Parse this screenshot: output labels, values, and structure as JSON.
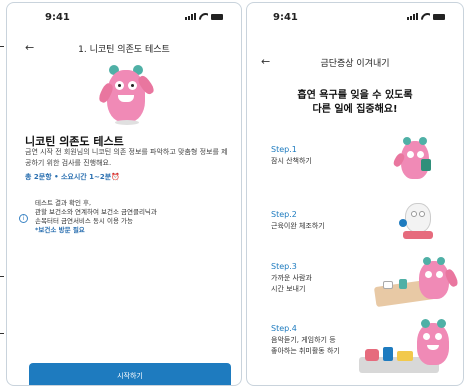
{
  "left_screen": {
    "status_time": "9:41",
    "back_glyph": "←",
    "title": "1. 니코틴 의존도 테스트",
    "card_title": "니코틴 의존도 테스트",
    "card_desc": "금연 시작 전 회원님의 니코틴 의존 정보를 파악하고 맞춤형 정보를 제공하기 위한 검사를 진행해요.",
    "meta": "총 2문항 • 소요시간 1~2분⏰",
    "info_icon": "i",
    "info_lines": [
      "테스트 결과 확인 후,",
      "관할 보건소와 연계하여 보건소 금연클리닉과",
      "손목터터 금연서비스 동시 이용 가능"
    ],
    "info_highlight": "*보건소 방문 필요",
    "start_button": "시작하기",
    "icons": {
      "back": "arrow-left-icon",
      "info": "info-icon"
    }
  },
  "right_screen": {
    "status_time": "9:41",
    "back_glyph": "←",
    "title": "금단증상 이겨내기",
    "hero_line1": "흡연 욕구를 잊을 수 있도록",
    "hero_line2": "다른 일에 집중해요!",
    "steps": [
      {
        "label": "Step.1",
        "lines": [
          "잠시 산책하기"
        ]
      },
      {
        "label": "Step.2",
        "lines": [
          "근육이완 체조하기"
        ]
      },
      {
        "label": "Step.3",
        "lines": [
          "가까운 사람과",
          "시간 보내기"
        ]
      },
      {
        "label": "Step.4",
        "lines": [
          "음악듣기, 게임하기 등",
          "좋아하는 취미활동 하기"
        ]
      }
    ],
    "icons": {
      "back": "arrow-left-icon"
    }
  },
  "colors": {
    "accent": "#1e7bbf",
    "mascot_pink": "#f08ab6",
    "mascot_teal": "#4fb0a6"
  }
}
